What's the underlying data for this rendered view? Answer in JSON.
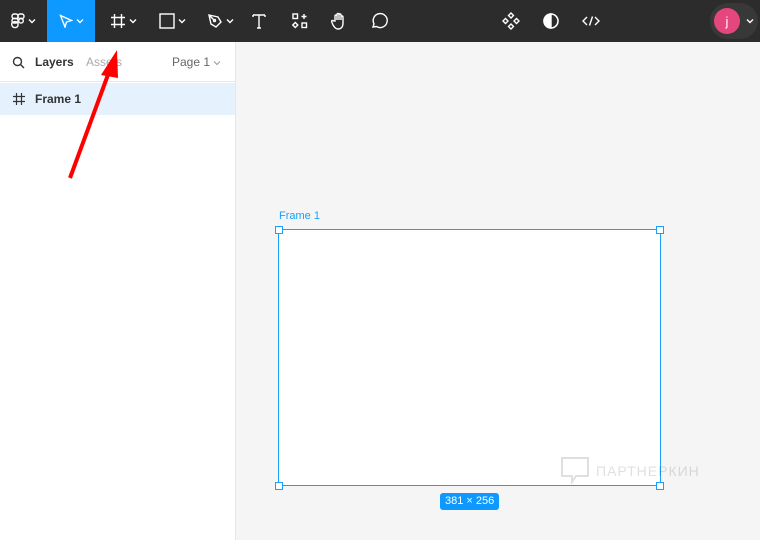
{
  "toolbar": {
    "tools": [
      "main-menu",
      "move",
      "frame",
      "shape",
      "pen",
      "text",
      "resources",
      "hand",
      "comment"
    ],
    "active": "move",
    "accent": "#0d99ff",
    "avatar_letter": "j",
    "avatar_color": "#e5467e"
  },
  "sidebar": {
    "tab_layers": "Layers",
    "tab_assets": "Assets",
    "page": "Page 1",
    "layers": [
      {
        "name": "Frame 1"
      }
    ]
  },
  "canvas": {
    "frame_label": "Frame 1",
    "size_badge": "381 × 256",
    "watermark": "ПАРТНЕРКИН"
  }
}
